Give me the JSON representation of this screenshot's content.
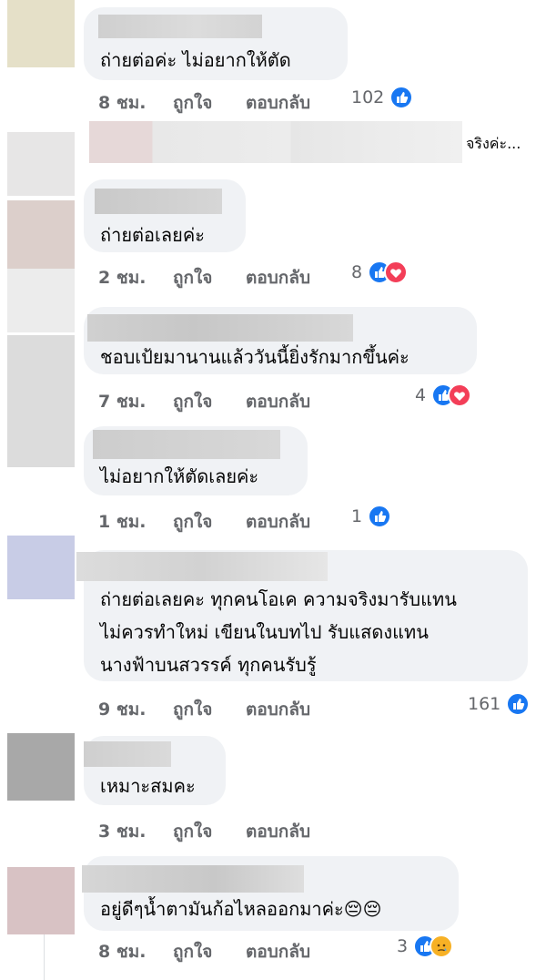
{
  "labels": {
    "like": "ถูกใจ",
    "reply": "ตอบกลับ"
  },
  "colors": {
    "bubble": "#f0f2f5",
    "meta": "#65676b",
    "like": "#1877f2",
    "love": "#f33e58",
    "sad": "#f7b125"
  },
  "comments": [
    {
      "text": [
        "ถ่ายต่อค่ะ ไม่อยากให้ตัด"
      ],
      "time": "8 ชม.",
      "reaction_count": "102",
      "reactions": [
        "like"
      ]
    },
    {
      "preview": "จริงค่ะ..."
    },
    {
      "text": [
        "ถ่ายต่อเลยค่ะ"
      ],
      "time": "2 ชม.",
      "reaction_count": "8",
      "reactions": [
        "like",
        "love"
      ]
    },
    {
      "text": [
        "ชอบเป้ยมานานแล้ววันนี้ยิ่งรักมากขึ้นค่ะ"
      ],
      "time": "7 ชม.",
      "reaction_count": "4",
      "reactions": [
        "like",
        "love"
      ]
    },
    {
      "text": [
        "ไม่อยากให้ตัดเลยค่ะ"
      ],
      "time": "1 ชม.",
      "reaction_count": "1",
      "reactions": [
        "like"
      ]
    },
    {
      "text": [
        "ถ่ายต่อเลยคะ ทุกคนโอเค ความจริงมารับแทน",
        "ไม่ควรทำใหม่ เขียนในบทไป รับแสดงแทน",
        "นางฟ้าบนสวรรค์ ทุกคนรับรู้"
      ],
      "time": "9 ชม.",
      "reaction_count": "161",
      "reactions": [
        "like"
      ]
    },
    {
      "text": [
        "เหมาะสมคะ"
      ],
      "time": "3 ชม.",
      "reaction_count": "",
      "reactions": []
    },
    {
      "text": [
        "อยู่ดีๆน้ำตามันก้อไหลออกมาค่ะ😔😔"
      ],
      "time": "8 ชม.",
      "reaction_count": "3",
      "reactions": [
        "like",
        "sad"
      ]
    }
  ]
}
